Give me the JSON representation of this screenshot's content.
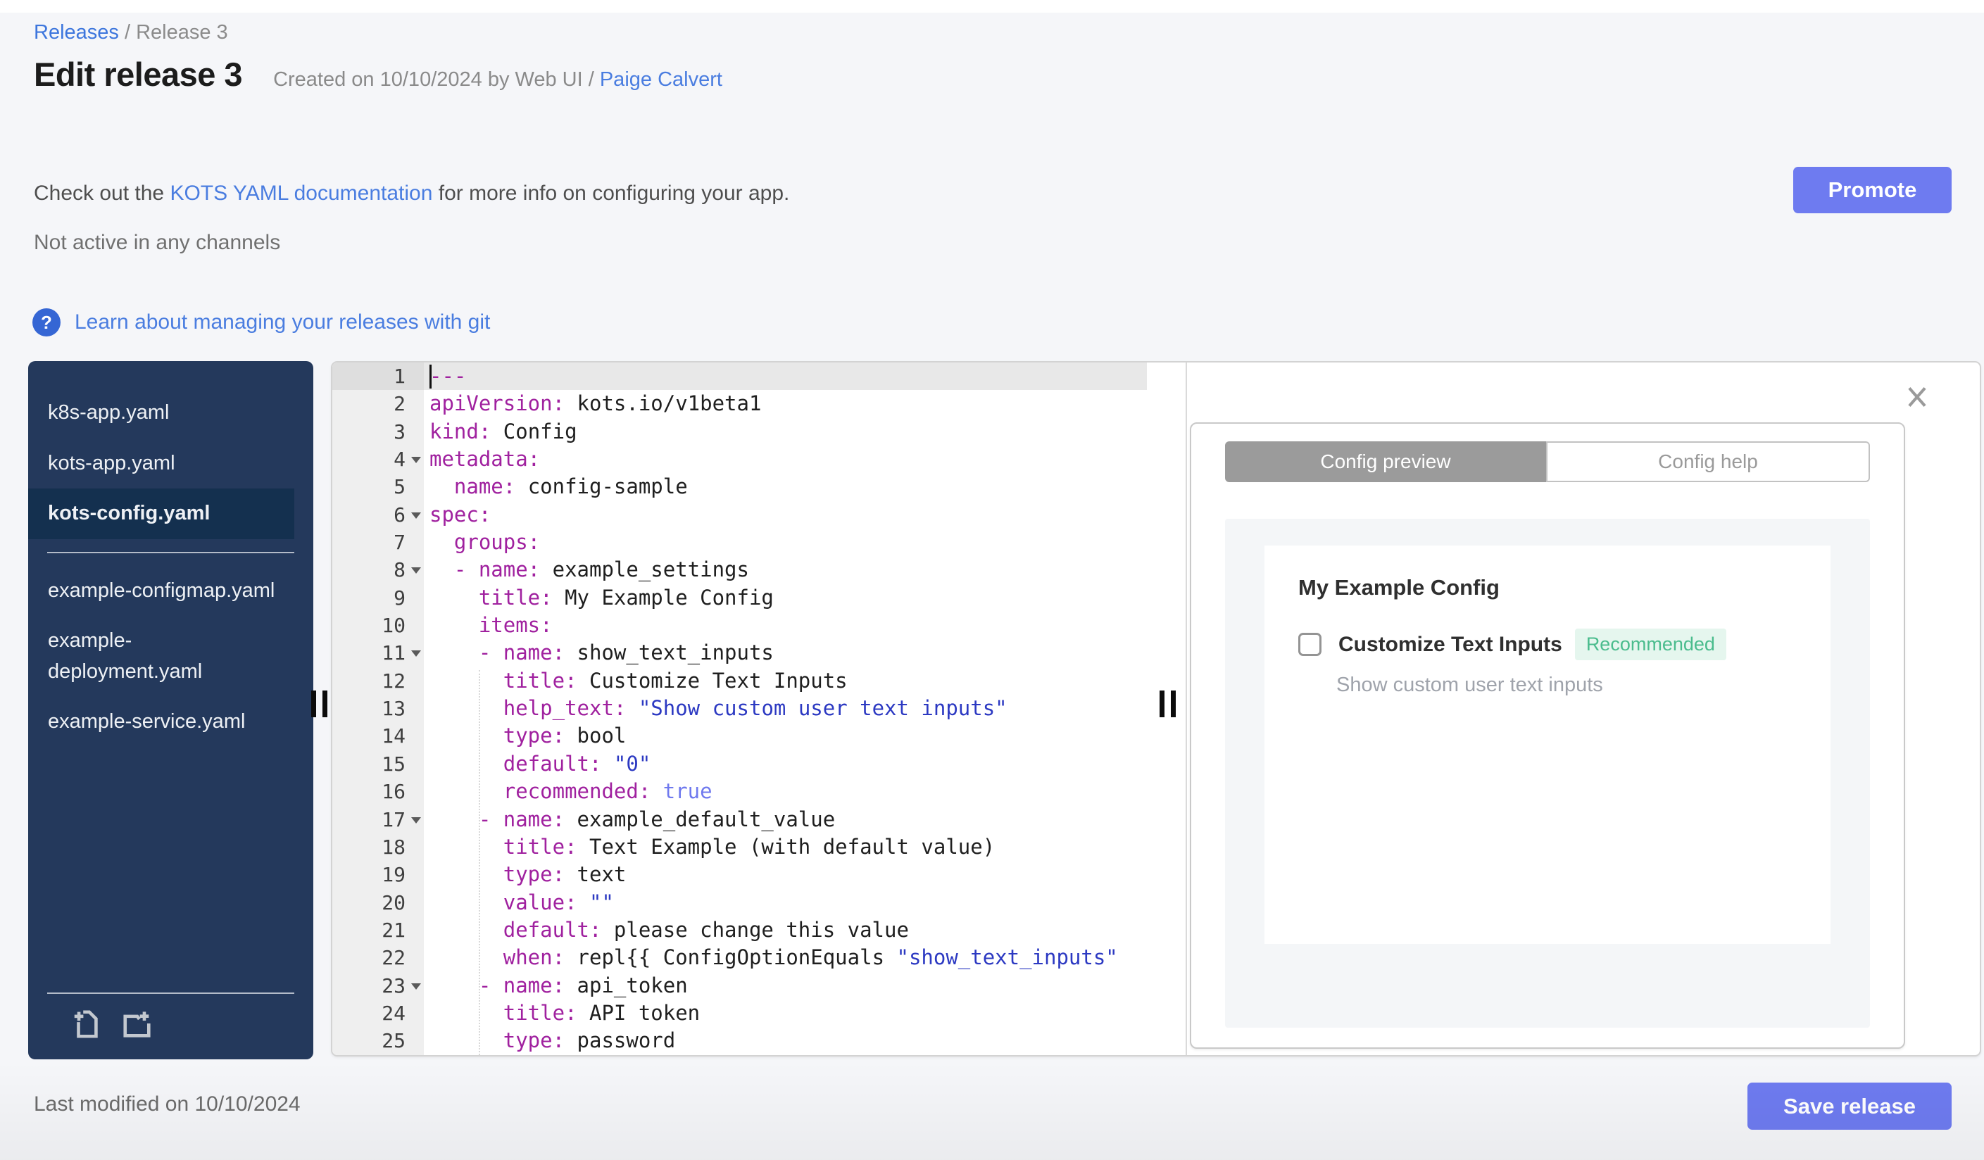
{
  "breadcrumb": {
    "link": "Releases",
    "separator": " / ",
    "current": "Release 3"
  },
  "header": {
    "title": "Edit release 3",
    "created_prefix": "Created on 10/10/2024 by Web UI / ",
    "created_link": "Paige Calvert"
  },
  "docs_line": {
    "before": "Check out the ",
    "link": "KOTS YAML documentation",
    "after": " for more info on configuring your app."
  },
  "status_line": "Not active in any channels",
  "git_link": {
    "icon": "question-circle-icon",
    "label": "Learn about managing your releases with git"
  },
  "promote_button": "Promote",
  "sidebar": {
    "files": [
      {
        "name": "k8s-app.yaml",
        "selected": false,
        "divider_after": false
      },
      {
        "name": "kots-app.yaml",
        "selected": false,
        "divider_after": false
      },
      {
        "name": "kots-config.yaml",
        "selected": true,
        "divider_after": true
      },
      {
        "name": "example-configmap.yaml",
        "selected": false,
        "divider_after": false
      },
      {
        "name": "example-deployment.yaml",
        "selected": false,
        "divider_after": false
      },
      {
        "name": "example-service.yaml",
        "selected": false,
        "divider_after": false
      }
    ],
    "icons": [
      "new-file-icon",
      "new-folder-icon"
    ]
  },
  "editor": {
    "lines": [
      {
        "n": 1,
        "active": true,
        "fold": false,
        "seg": [
          [
            "k",
            "---"
          ]
        ]
      },
      {
        "n": 2,
        "active": false,
        "fold": false,
        "seg": [
          [
            "k",
            "apiVersion:"
          ],
          [
            "p",
            " kots.io/v1beta1"
          ]
        ]
      },
      {
        "n": 3,
        "active": false,
        "fold": false,
        "seg": [
          [
            "k",
            "kind:"
          ],
          [
            "p",
            " Config"
          ]
        ]
      },
      {
        "n": 4,
        "active": false,
        "fold": true,
        "seg": [
          [
            "k",
            "metadata:"
          ]
        ]
      },
      {
        "n": 5,
        "active": false,
        "fold": false,
        "seg": [
          [
            "p",
            "  "
          ],
          [
            "k",
            "name:"
          ],
          [
            "p",
            " config-sample"
          ]
        ]
      },
      {
        "n": 6,
        "active": false,
        "fold": true,
        "seg": [
          [
            "k",
            "spec:"
          ]
        ]
      },
      {
        "n": 7,
        "active": false,
        "fold": false,
        "seg": [
          [
            "p",
            "  "
          ],
          [
            "k",
            "groups:"
          ]
        ]
      },
      {
        "n": 8,
        "active": false,
        "fold": true,
        "seg": [
          [
            "p",
            "  "
          ],
          [
            "d",
            "- "
          ],
          [
            "k",
            "name:"
          ],
          [
            "p",
            " example_settings"
          ]
        ]
      },
      {
        "n": 9,
        "active": false,
        "fold": false,
        "seg": [
          [
            "p",
            "    "
          ],
          [
            "k",
            "title:"
          ],
          [
            "p",
            " My Example Config"
          ]
        ]
      },
      {
        "n": 10,
        "active": false,
        "fold": false,
        "seg": [
          [
            "p",
            "    "
          ],
          [
            "k",
            "items:"
          ]
        ]
      },
      {
        "n": 11,
        "active": false,
        "fold": true,
        "seg": [
          [
            "p",
            "    "
          ],
          [
            "d",
            "- "
          ],
          [
            "k",
            "name:"
          ],
          [
            "p",
            " show_text_inputs"
          ]
        ]
      },
      {
        "n": 12,
        "active": false,
        "fold": false,
        "seg": [
          [
            "p",
            "      "
          ],
          [
            "k",
            "title:"
          ],
          [
            "p",
            " Customize Text Inputs"
          ]
        ]
      },
      {
        "n": 13,
        "active": false,
        "fold": false,
        "seg": [
          [
            "p",
            "      "
          ],
          [
            "k",
            "help_text:"
          ],
          [
            "p",
            " "
          ],
          [
            "s",
            "\"Show custom user text inputs\""
          ]
        ]
      },
      {
        "n": 14,
        "active": false,
        "fold": false,
        "seg": [
          [
            "p",
            "      "
          ],
          [
            "k",
            "type:"
          ],
          [
            "p",
            " bool"
          ]
        ]
      },
      {
        "n": 15,
        "active": false,
        "fold": false,
        "seg": [
          [
            "p",
            "      "
          ],
          [
            "k",
            "default:"
          ],
          [
            "p",
            " "
          ],
          [
            "s",
            "\"0\""
          ]
        ]
      },
      {
        "n": 16,
        "active": false,
        "fold": false,
        "seg": [
          [
            "p",
            "      "
          ],
          [
            "k",
            "recommended:"
          ],
          [
            "p",
            " "
          ],
          [
            "c",
            "true"
          ]
        ]
      },
      {
        "n": 17,
        "active": false,
        "fold": true,
        "seg": [
          [
            "p",
            "    "
          ],
          [
            "d",
            "- "
          ],
          [
            "k",
            "name:"
          ],
          [
            "p",
            " example_default_value"
          ]
        ]
      },
      {
        "n": 18,
        "active": false,
        "fold": false,
        "seg": [
          [
            "p",
            "      "
          ],
          [
            "k",
            "title:"
          ],
          [
            "p",
            " Text Example (with default value)"
          ]
        ]
      },
      {
        "n": 19,
        "active": false,
        "fold": false,
        "seg": [
          [
            "p",
            "      "
          ],
          [
            "k",
            "type:"
          ],
          [
            "p",
            " text"
          ]
        ]
      },
      {
        "n": 20,
        "active": false,
        "fold": false,
        "seg": [
          [
            "p",
            "      "
          ],
          [
            "k",
            "value:"
          ],
          [
            "p",
            " "
          ],
          [
            "s",
            "\"\""
          ]
        ]
      },
      {
        "n": 21,
        "active": false,
        "fold": false,
        "seg": [
          [
            "p",
            "      "
          ],
          [
            "k",
            "default:"
          ],
          [
            "p",
            " please change this value"
          ]
        ]
      },
      {
        "n": 22,
        "active": false,
        "fold": false,
        "seg": [
          [
            "p",
            "      "
          ],
          [
            "k",
            "when:"
          ],
          [
            "p",
            " repl{{ ConfigOptionEquals "
          ],
          [
            "s",
            "\"show_text_inputs\""
          ]
        ]
      },
      {
        "n": 23,
        "active": false,
        "fold": true,
        "seg": [
          [
            "p",
            "    "
          ],
          [
            "d",
            "- "
          ],
          [
            "k",
            "name:"
          ],
          [
            "p",
            " api_token"
          ]
        ]
      },
      {
        "n": 24,
        "active": false,
        "fold": false,
        "seg": [
          [
            "p",
            "      "
          ],
          [
            "k",
            "title:"
          ],
          [
            "p",
            " API token"
          ]
        ]
      },
      {
        "n": 25,
        "active": false,
        "fold": false,
        "seg": [
          [
            "p",
            "      "
          ],
          [
            "k",
            "type:"
          ],
          [
            "p",
            " password"
          ]
        ]
      }
    ]
  },
  "panel": {
    "tabs": [
      {
        "label": "Config preview",
        "active": true
      },
      {
        "label": "Config help",
        "active": false
      }
    ],
    "close_icon": "close-icon",
    "preview": {
      "group_title": "My Example Config",
      "item_label": "Customize Text Inputs",
      "badge": "Recommended",
      "help_text": "Show custom user text inputs",
      "checkbox_checked": false
    }
  },
  "footer": {
    "last_modified": "Last modified on 10/10/2024",
    "save_button": "Save release"
  },
  "colors": {
    "accent_button": "#6e7bf0",
    "link_blue": "#4a7de0",
    "sidebar_bg": "#24395c",
    "sidebar_selected": "#14304f",
    "yaml_key": "#a0219f",
    "yaml_string": "#2c39c2",
    "yaml_constant": "#6f79ee",
    "active_tab_gray": "#9b9b9b",
    "badge_green_text": "#4abc8d",
    "badge_green_bg": "#e5f6ee"
  }
}
